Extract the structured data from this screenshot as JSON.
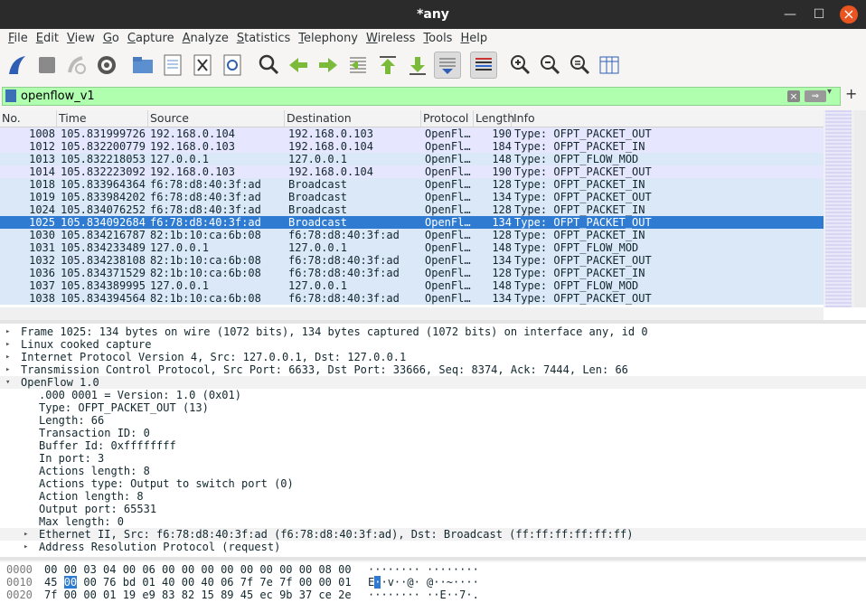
{
  "window": {
    "title": "*any"
  },
  "menu": [
    "File",
    "Edit",
    "View",
    "Go",
    "Capture",
    "Analyze",
    "Statistics",
    "Telephony",
    "Wireless",
    "Tools",
    "Help"
  ],
  "filter": {
    "value": "openflow_v1"
  },
  "columns": [
    "No.",
    "Time",
    "Source",
    "Destination",
    "Protocol",
    "Length",
    "Info"
  ],
  "packets": [
    {
      "no": "1008",
      "time": "105.831999726",
      "src": "192.168.0.104",
      "dst": "192.168.0.103",
      "proto": "OpenFl…",
      "len": "190",
      "info": "Type: OFPT_PACKET_OUT",
      "cls": "out"
    },
    {
      "no": "1012",
      "time": "105.832200779",
      "src": "192.168.0.103",
      "dst": "192.168.0.104",
      "proto": "OpenFl…",
      "len": "184",
      "info": "Type: OFPT_PACKET_IN",
      "cls": "out"
    },
    {
      "no": "1013",
      "time": "105.832218053",
      "src": "127.0.0.1",
      "dst": "127.0.0.1",
      "proto": "OpenFl…",
      "len": "148",
      "info": "Type: OFPT_FLOW_MOD",
      "cls": "in"
    },
    {
      "no": "1014",
      "time": "105.832223092",
      "src": "192.168.0.103",
      "dst": "192.168.0.104",
      "proto": "OpenFl…",
      "len": "190",
      "info": "Type: OFPT_PACKET_OUT",
      "cls": "out"
    },
    {
      "no": "1018",
      "time": "105.833964364",
      "src": "f6:78:d8:40:3f:ad",
      "dst": "Broadcast",
      "proto": "OpenFl…",
      "len": "128",
      "info": "Type: OFPT_PACKET_IN",
      "cls": "in"
    },
    {
      "no": "1019",
      "time": "105.833984202",
      "src": "f6:78:d8:40:3f:ad",
      "dst": "Broadcast",
      "proto": "OpenFl…",
      "len": "134",
      "info": "Type: OFPT_PACKET_OUT",
      "cls": "in"
    },
    {
      "no": "1024",
      "time": "105.834076252",
      "src": "f6:78:d8:40:3f:ad",
      "dst": "Broadcast",
      "proto": "OpenFl…",
      "len": "128",
      "info": "Type: OFPT_PACKET_IN",
      "cls": "in"
    },
    {
      "no": "1025",
      "time": "105.834092684",
      "src": "f6:78:d8:40:3f:ad",
      "dst": "Broadcast",
      "proto": "OpenFl…",
      "len": "134",
      "info": "Type: OFPT_PACKET_OUT",
      "cls": "sel"
    },
    {
      "no": "1030",
      "time": "105.834216787",
      "src": "82:1b:10:ca:6b:08",
      "dst": "f6:78:d8:40:3f:ad",
      "proto": "OpenFl…",
      "len": "128",
      "info": "Type: OFPT_PACKET_IN",
      "cls": "in"
    },
    {
      "no": "1031",
      "time": "105.834233489",
      "src": "127.0.0.1",
      "dst": "127.0.0.1",
      "proto": "OpenFl…",
      "len": "148",
      "info": "Type: OFPT_FLOW_MOD",
      "cls": "in"
    },
    {
      "no": "1032",
      "time": "105.834238108",
      "src": "82:1b:10:ca:6b:08",
      "dst": "f6:78:d8:40:3f:ad",
      "proto": "OpenFl…",
      "len": "134",
      "info": "Type: OFPT_PACKET_OUT",
      "cls": "in"
    },
    {
      "no": "1036",
      "time": "105.834371529",
      "src": "82:1b:10:ca:6b:08",
      "dst": "f6:78:d8:40:3f:ad",
      "proto": "OpenFl…",
      "len": "128",
      "info": "Type: OFPT_PACKET_IN",
      "cls": "in"
    },
    {
      "no": "1037",
      "time": "105.834389995",
      "src": "127.0.0.1",
      "dst": "127.0.0.1",
      "proto": "OpenFl…",
      "len": "148",
      "info": "Type: OFPT_FLOW_MOD",
      "cls": "in"
    },
    {
      "no": "1038",
      "time": "105.834394564",
      "src": "82:1b:10:ca:6b:08",
      "dst": "f6:78:d8:40:3f:ad",
      "proto": "OpenFl…",
      "len": "134",
      "info": "Type: OFPT_PACKET_OUT",
      "cls": "in"
    }
  ],
  "details": [
    {
      "text": "Frame 1025: 134 bytes on wire (1072 bits), 134 bytes captured (1072 bits) on interface any, id 0",
      "level": 0,
      "arrow": "▸"
    },
    {
      "text": "Linux cooked capture",
      "level": 0,
      "arrow": "▸"
    },
    {
      "text": "Internet Protocol Version 4, Src: 127.0.0.1, Dst: 127.0.0.1",
      "level": 0,
      "arrow": "▸"
    },
    {
      "text": "Transmission Control Protocol, Src Port: 6633, Dst Port: 33666, Seq: 8374, Ack: 7444, Len: 66",
      "level": 0,
      "arrow": "▸"
    },
    {
      "text": "OpenFlow 1.0",
      "level": 0,
      "arrow": "▾",
      "alt": true
    },
    {
      "text": ".000 0001 = Version: 1.0 (0x01)",
      "level": 1,
      "arrow": ""
    },
    {
      "text": "Type: OFPT_PACKET_OUT (13)",
      "level": 1,
      "arrow": ""
    },
    {
      "text": "Length: 66",
      "level": 1,
      "arrow": ""
    },
    {
      "text": "Transaction ID: 0",
      "level": 1,
      "arrow": ""
    },
    {
      "text": "Buffer Id: 0xffffffff",
      "level": 1,
      "arrow": ""
    },
    {
      "text": "In port: 3",
      "level": 1,
      "arrow": ""
    },
    {
      "text": "Actions length: 8",
      "level": 1,
      "arrow": ""
    },
    {
      "text": "Actions type: Output to switch port (0)",
      "level": 1,
      "arrow": ""
    },
    {
      "text": "Action length: 8",
      "level": 1,
      "arrow": ""
    },
    {
      "text": "Output port: 65531",
      "level": 1,
      "arrow": ""
    },
    {
      "text": "Max length: 0",
      "level": 1,
      "arrow": ""
    },
    {
      "text": "Ethernet II, Src: f6:78:d8:40:3f:ad (f6:78:d8:40:3f:ad), Dst: Broadcast (ff:ff:ff:ff:ff:ff)",
      "level": 1,
      "arrow": "▸",
      "alt": true
    },
    {
      "text": "Address Resolution Protocol (request)",
      "level": 1,
      "arrow": "▸"
    }
  ],
  "hex": [
    {
      "off": "0000",
      "bytes": "00 00 03 04 00 06 00 00  00 00 00 00 00 00 08 00",
      "asc": "········ ········"
    },
    {
      "off": "0010",
      "bytes_a": "45 ",
      "bytes_hl": "00",
      "bytes_b": " 00 76 bd 01 40 00  40 06 7f 7e 7f 00 00 01",
      "asc_a": "E",
      "asc_hl": "·",
      "asc_b": "·v··@·  @··~····"
    },
    {
      "off": "0020",
      "bytes": "7f 00 00 01 19 e9 83 82  15 89 45 ec 9b 37 ce 2e",
      "asc": "········ ··E··7·."
    }
  ]
}
